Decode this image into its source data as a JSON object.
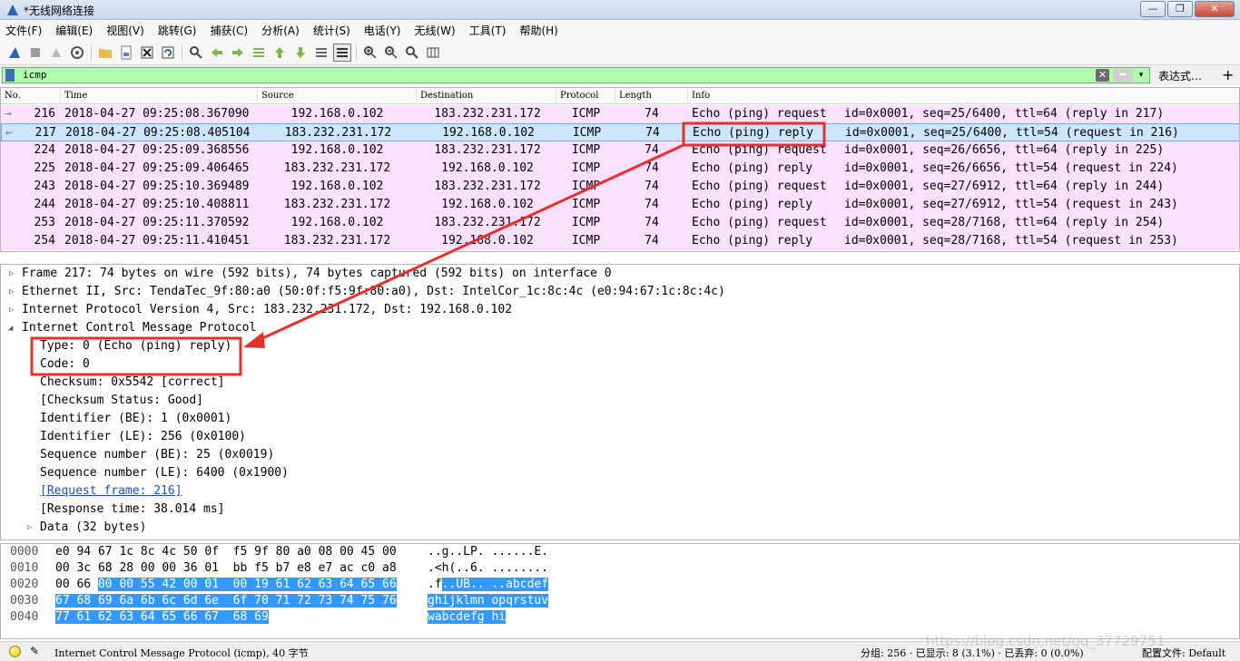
{
  "window": {
    "title": "*无线网络连接",
    "buttons": [
      "—",
      "❐",
      "✕"
    ]
  },
  "menu": [
    "文件(F)",
    "编辑(E)",
    "视图(V)",
    "跳转(G)",
    "捕获(C)",
    "分析(A)",
    "统计(S)",
    "电话(Y)",
    "无线(W)",
    "工具(T)",
    "帮助(H)"
  ],
  "toolbar": {
    "icons": [
      "shark-fin-icon",
      "stop-icon",
      "restart-icon",
      "options-gear-icon",
      "open-folder-icon",
      "save-file-icon",
      "close-file-icon",
      "reload-icon",
      "find-icon",
      "back-arrow-icon",
      "forward-arrow-icon",
      "go-to-packet-icon",
      "first-packet-icon",
      "last-packet-icon",
      "autoscroll-icon",
      "colorize-icon",
      "zoom-in-icon",
      "zoom-out-icon",
      "zoom-normal-icon",
      "resize-columns-icon"
    ]
  },
  "filter": {
    "value": "icmp",
    "clear": "✕",
    "apply": "➡",
    "dropdown": "▾",
    "expression_label": "表达式…",
    "add_label": "+"
  },
  "packet_list": {
    "columns": [
      "No.",
      "Time",
      "Source",
      "Destination",
      "Protocol",
      "Length",
      "Info"
    ],
    "rows": [
      {
        "marker": "→",
        "no": "216",
        "time": "2018-04-27 09:25:08.367090",
        "src": "192.168.0.102",
        "dst": "183.232.231.172",
        "proto": "ICMP",
        "len": "74",
        "info_type": "Echo (ping) request",
        "info_rest": "id=0x0001, seq=25/6400, ttl=64 (reply in 217)"
      },
      {
        "marker": "←",
        "no": "217",
        "time": "2018-04-27 09:25:08.405104",
        "src": "183.232.231.172",
        "dst": "192.168.0.102",
        "proto": "ICMP",
        "len": "74",
        "info_type": "Echo (ping) reply",
        "info_rest": "id=0x0001, seq=25/6400, ttl=54 (request in 216)"
      },
      {
        "marker": "",
        "no": "224",
        "time": "2018-04-27 09:25:09.368556",
        "src": "192.168.0.102",
        "dst": "183.232.231.172",
        "proto": "ICMP",
        "len": "74",
        "info_type": "Echo (ping) request",
        "info_rest": "id=0x0001, seq=26/6656, ttl=64 (reply in 225)"
      },
      {
        "marker": "",
        "no": "225",
        "time": "2018-04-27 09:25:09.406465",
        "src": "183.232.231.172",
        "dst": "192.168.0.102",
        "proto": "ICMP",
        "len": "74",
        "info_type": "Echo (ping) reply",
        "info_rest": "id=0x0001, seq=26/6656, ttl=54 (request in 224)"
      },
      {
        "marker": "",
        "no": "243",
        "time": "2018-04-27 09:25:10.369489",
        "src": "192.168.0.102",
        "dst": "183.232.231.172",
        "proto": "ICMP",
        "len": "74",
        "info_type": "Echo (ping) request",
        "info_rest": "id=0x0001, seq=27/6912, ttl=64 (reply in 244)"
      },
      {
        "marker": "",
        "no": "244",
        "time": "2018-04-27 09:25:10.408811",
        "src": "183.232.231.172",
        "dst": "192.168.0.102",
        "proto": "ICMP",
        "len": "74",
        "info_type": "Echo (ping) reply",
        "info_rest": "id=0x0001, seq=27/6912, ttl=54 (request in 243)"
      },
      {
        "marker": "",
        "no": "253",
        "time": "2018-04-27 09:25:11.370592",
        "src": "192.168.0.102",
        "dst": "183.232.231.172",
        "proto": "ICMP",
        "len": "74",
        "info_type": "Echo (ping) request",
        "info_rest": "id=0x0001, seq=28/7168, ttl=64 (reply in 254)"
      },
      {
        "marker": "",
        "no": "254",
        "time": "2018-04-27 09:25:11.410451",
        "src": "183.232.231.172",
        "dst": "192.168.0.102",
        "proto": "ICMP",
        "len": "74",
        "info_type": "Echo (ping) reply",
        "info_rest": "id=0x0001, seq=28/7168, ttl=54 (request in 253)"
      }
    ],
    "selected_row": 1,
    "row_color": "#fce0ff",
    "selected_color": "#cce6ff"
  },
  "details": {
    "frame": "Frame 217: 74 bytes on wire (592 bits), 74 bytes captured (592 bits) on interface 0",
    "ethernet": "Ethernet II, Src: TendaTec_9f:80:a0 (50:0f:f5:9f:80:a0), Dst: IntelCor_1c:8c:4c (e0:94:67:1c:8c:4c)",
    "ip": "Internet Protocol Version 4, Src: 183.232.231.172, Dst: 192.168.0.102",
    "icmp": "Internet Control Message Protocol",
    "icmp_fields": [
      "Type: 0 (Echo (ping) reply)",
      "Code: 0",
      "Checksum: 0x5542 [correct]",
      "[Checksum Status: Good]",
      "Identifier (BE): 1 (0x0001)",
      "Identifier (LE): 256 (0x0100)",
      "Sequence number (BE): 25 (0x0019)",
      "Sequence number (LE): 6400 (0x1900)"
    ],
    "request_frame": "[Request frame: 216]",
    "response_time": "[Response time: 38.014 ms]",
    "data": "Data (32 bytes)"
  },
  "bytes": [
    {
      "offset": "0000",
      "hex_plain": "e0 94 67 1c 8c 4c 50 0f  f5 9f 80 a0 08 00 45 00",
      "hex_hl": "",
      "ascii_plain": "..g..LP. ......E.",
      "ascii_hl": ""
    },
    {
      "offset": "0010",
      "hex_plain": "00 3c 68 28 00 00 36 01  bb f5 b7 e8 e7 ac c0 a8",
      "hex_hl": "",
      "ascii_plain": ".<h(..6. ........",
      "ascii_hl": ""
    },
    {
      "offset": "0020",
      "hex_plain": "00 66 ",
      "hex_hl": "00 00 55 42 00 01  00 19 61 62 63 64 65 66",
      "ascii_plain": ".f",
      "ascii_hl": "..UB.. ..abcdef"
    },
    {
      "offset": "0030",
      "hex_plain": "",
      "hex_hl": "67 68 69 6a 6b 6c 6d 6e  6f 70 71 72 73 74 75 76",
      "ascii_plain": "",
      "ascii_hl": "ghijklmn opqrstuv"
    },
    {
      "offset": "0040",
      "hex_plain": "",
      "hex_hl": "77 61 62 63 64 65 66 67  68 69",
      "ascii_plain": "",
      "ascii_hl": "wabcdefg hi"
    }
  ],
  "status": {
    "protocol_text": "Internet Control Message Protocol (icmp), 40 字节",
    "groups": "分组: 256 · 已显示: 8 (3.1%) · 已丢弃: 0 (0.0%)",
    "profile": "配置文件: Default"
  },
  "watermark": "https://blog.csdn.net/qq_37729751"
}
